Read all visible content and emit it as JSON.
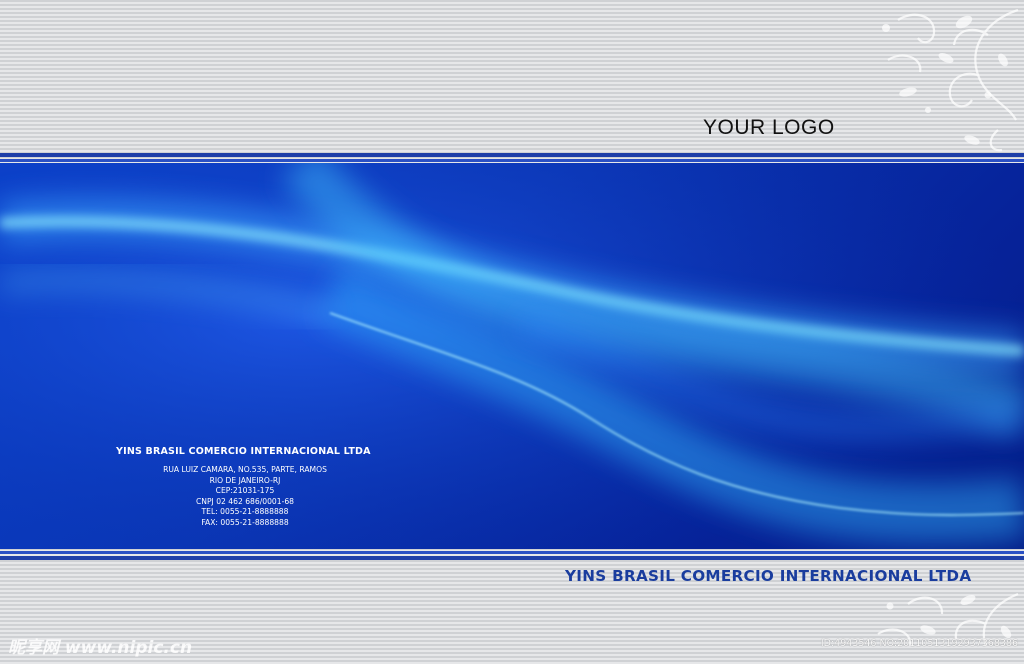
{
  "logo": {
    "text": "YOUR LOGO"
  },
  "company": {
    "name_small": "YINS BRASIL COMERCIO INTERNACIONAL LTDA",
    "name_large": "YINS BRASIL COMERCIO INTERNACIONAL LTDA"
  },
  "address_lines": [
    "RUA  LUIZ  CAMARA, NO.535,  PARTE, RAMOS",
    "RIO DE JANEIRO-RJ",
    "CEP:21031-175",
    "CNPJ 02 462 686/0001-68",
    "TEL: 0055-21-8888888",
    "FAX: 0055-21-8888888"
  ],
  "watermark": {
    "left": "昵享网 www.nipic.cn",
    "right": "ID:4943546 NO:20110513192937368386"
  },
  "colors": {
    "stripe_light": "#e6e7e9",
    "stripe_dark": "#cfd1d4",
    "rule_blue": "#1f3fa8",
    "panel_blue": "#0a3fc8",
    "glow_cyan": "#6fe6ff",
    "company_large_text": "#1a3d9e"
  },
  "icons": [
    "floral-ornament-icon"
  ]
}
